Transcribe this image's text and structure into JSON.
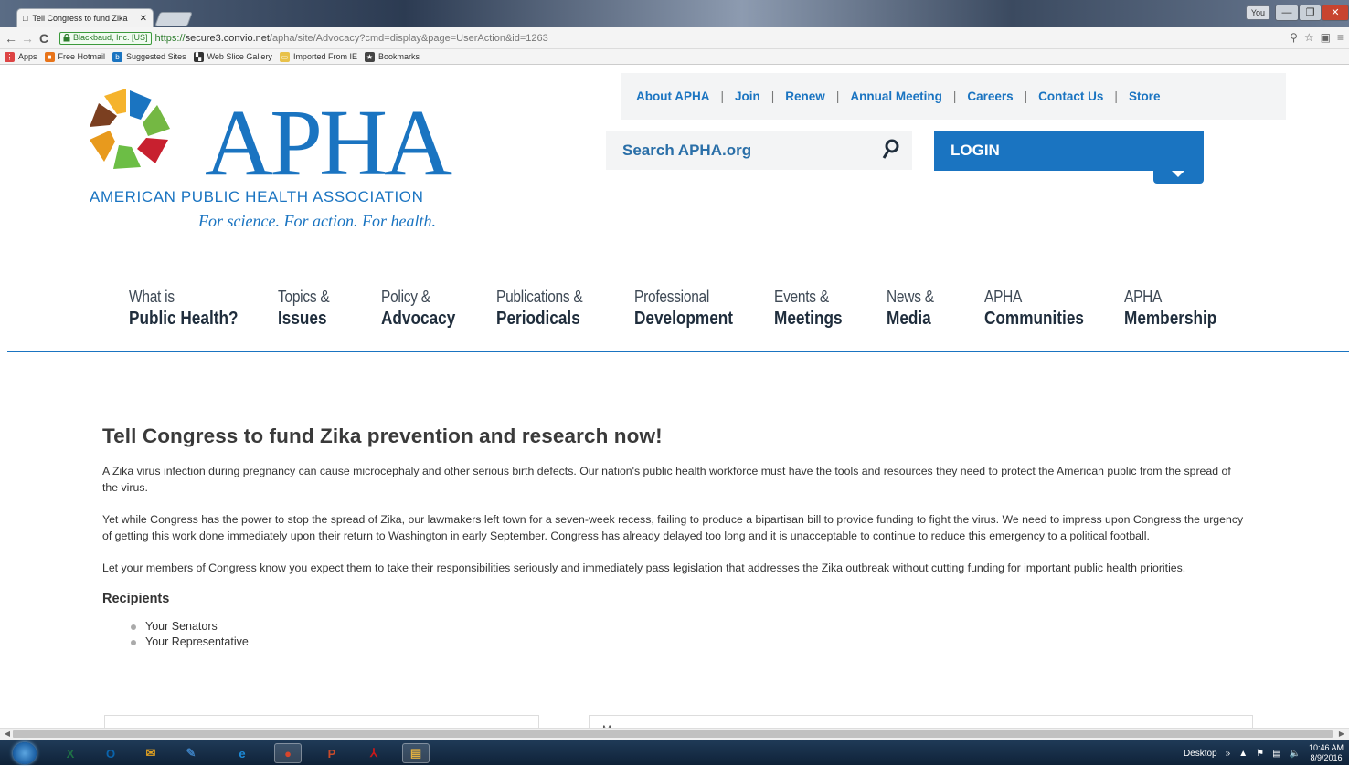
{
  "browser": {
    "tab_title": "Tell Congress to fund Zika",
    "tab_close": "✕",
    "window_user": "You",
    "win_min": "—",
    "win_max": "❐",
    "win_close": "✕",
    "nav_back": "←",
    "nav_forward": "→",
    "nav_reload": "C",
    "secure_label": "Blackbaud, Inc. [US]",
    "url_scheme": "https://",
    "url_host": "secure3.convio.net",
    "url_path": "/apha/site/Advocacy?cmd=display&page=UserAction&id=1263",
    "toolbar_icons": [
      "zoom-icon",
      "star-icon",
      "extension-icon",
      "menu-icon"
    ],
    "bookmarks": [
      {
        "label": "Apps",
        "icon": "apps-grid-icon",
        "color": "#d44"
      },
      {
        "label": "Free Hotmail",
        "icon": "windows-icon",
        "color": "#e8741a"
      },
      {
        "label": "Suggested Sites",
        "icon": "bing-icon",
        "color": "#1a74c1"
      },
      {
        "label": "Web Slice Gallery",
        "icon": "webslice-icon",
        "color": "#333"
      },
      {
        "label": "Imported From IE",
        "icon": "folder-icon",
        "color": "#e8c14a"
      },
      {
        "label": "Bookmarks",
        "icon": "star-icon",
        "color": "#444"
      }
    ]
  },
  "header": {
    "logo_text": "APHA",
    "org_name": "AMERICAN PUBLIC HEALTH ASSOCIATION",
    "tagline": "For science. For action. For health.",
    "utility_links": [
      "About APHA",
      "Join",
      "Renew",
      "Annual Meeting",
      "Careers",
      "Contact Us",
      "Store"
    ],
    "utility_separator": "|",
    "search_placeholder": "Search APHA.org",
    "login_label": "LOGIN"
  },
  "main_nav": [
    {
      "top": "What is",
      "bottom": "Public Health?"
    },
    {
      "top": "Topics &",
      "bottom": "Issues"
    },
    {
      "top": "Policy &",
      "bottom": "Advocacy"
    },
    {
      "top": "Publications &",
      "bottom": "Periodicals"
    },
    {
      "top": "Professional",
      "bottom": "Development"
    },
    {
      "top": "Events &",
      "bottom": "Meetings"
    },
    {
      "top": "News &",
      "bottom": "Media"
    },
    {
      "top": "APHA",
      "bottom": "Communities"
    },
    {
      "top": "APHA",
      "bottom": "Membership"
    }
  ],
  "article": {
    "title": "Tell Congress to fund Zika prevention and research now!",
    "paragraphs": [
      "A Zika virus infection during pregnancy can cause microcephaly and other serious birth defects. Our nation's public health workforce must have the tools and resources they need to protect the American public from the spread of the virus.",
      "Yet while Congress has the power to stop the spread of Zika, our lawmakers left town for a seven-week recess, failing to produce a bipartisan bill to provide funding to fight the virus. We need to impress upon Congress the urgency of getting this work done immediately upon their return to Washington in early September. Congress has already delayed too long and it is unacceptable to continue to reduce this emergency to a political football.",
      "Let your members of Congress know you expect them to take their responsibilities seriously and immediately pass legislation that addresses the Zika outbreak without cutting funding for important public health priorities."
    ],
    "recipients_heading": "Recipients",
    "recipients": [
      "Your Senators",
      "Your Representative"
    ],
    "form_right_stub": "M"
  },
  "taskbar": {
    "apps": [
      {
        "name": "excel-icon",
        "glyph": "X",
        "color": "#1e7145"
      },
      {
        "name": "outlook-icon",
        "glyph": "O",
        "color": "#0a64ad"
      },
      {
        "name": "mail-icon",
        "glyph": "✉",
        "color": "#e0a020"
      },
      {
        "name": "pen-icon",
        "glyph": "✎",
        "color": "#3c7fc0"
      },
      {
        "name": "ie-icon",
        "glyph": "e",
        "color": "#1c8ad8"
      },
      {
        "name": "chrome-icon",
        "glyph": "●",
        "color": "#d8452b"
      },
      {
        "name": "presentation-icon",
        "glyph": "P",
        "color": "#c84a2a"
      },
      {
        "name": "pdf-icon",
        "glyph": "⅄",
        "color": "#c8191a"
      },
      {
        "name": "explorer-icon",
        "glyph": "▤",
        "color": "#e2b040"
      }
    ],
    "desktop_label": "Desktop",
    "chevron": "»",
    "time": "10:46 AM",
    "date": "8/9/2016"
  },
  "colors": {
    "brand_blue": "#1a74c1",
    "nav_text": "#1f2d3c"
  }
}
